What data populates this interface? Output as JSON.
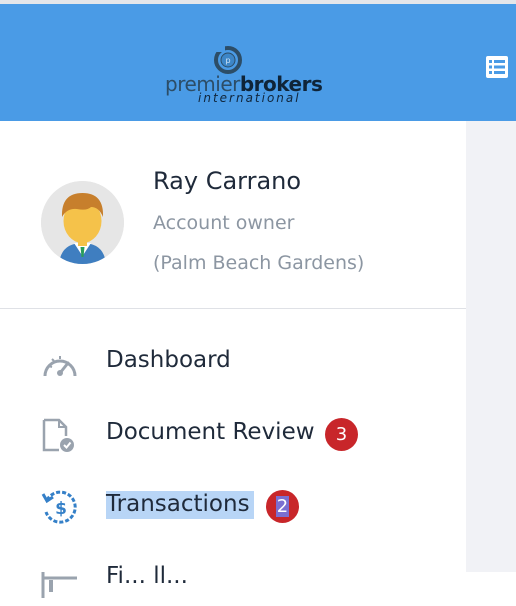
{
  "header": {
    "logo_text_primary": "premier",
    "logo_text_bold": "brokers",
    "logo_text_sub": "international",
    "menu_icon": "list-icon",
    "bg_color": "#4a9be6"
  },
  "profile": {
    "name": "Ray Carrano",
    "role": "Account owner",
    "office": "(Palm Beach Gardens)"
  },
  "nav": {
    "dashboard": {
      "label": "Dashboard",
      "icon": "speedometer-icon"
    },
    "document_review": {
      "label": "Document Review",
      "icon": "document-check-icon",
      "badge": "3"
    },
    "transactions": {
      "label": "Transactions",
      "icon": "dollar-history-icon",
      "badge": "2"
    },
    "next": {
      "label": "Fi... ll...",
      "icon": "chart-icon"
    }
  },
  "colors": {
    "badge": "#c8262a",
    "selection": "#b8d5f6"
  }
}
